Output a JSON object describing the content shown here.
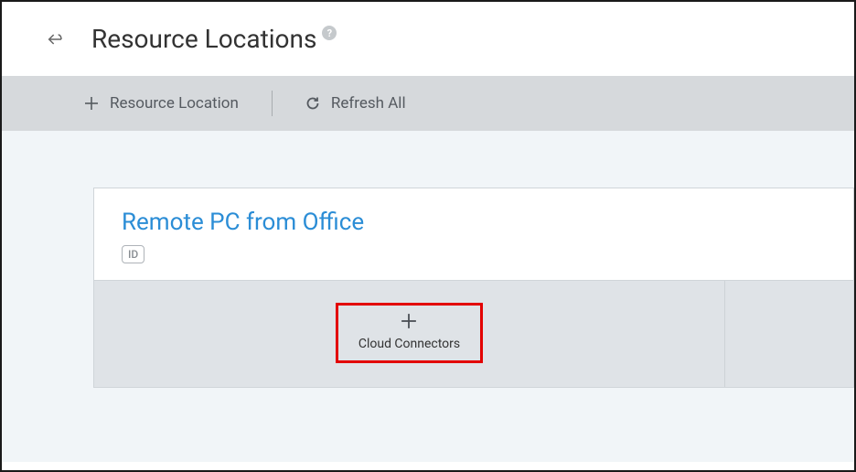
{
  "header": {
    "title": "Resource Locations",
    "help_glyph": "?"
  },
  "toolbar": {
    "add_label": "Resource Location",
    "refresh_label": "Refresh All"
  },
  "card": {
    "title": "Remote PC from Office",
    "id_badge": "ID",
    "actions": {
      "cloud_connectors": "Cloud Connectors"
    }
  }
}
